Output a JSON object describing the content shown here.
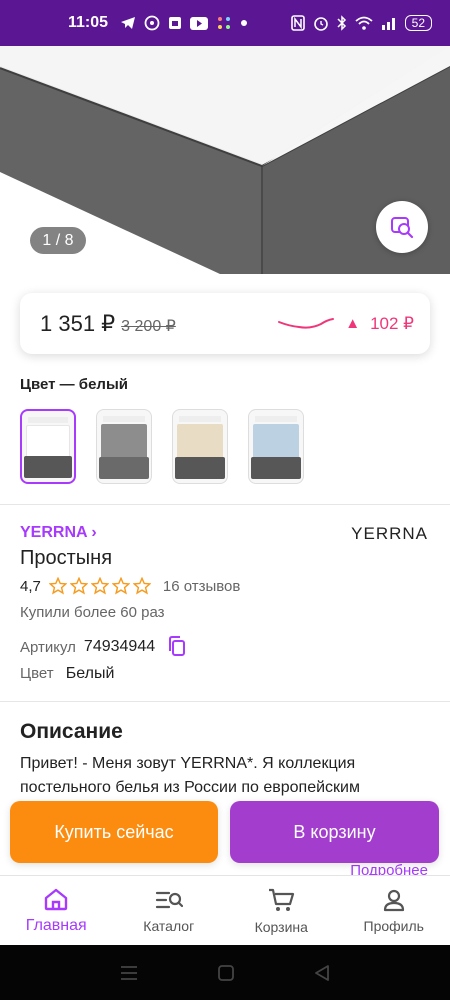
{
  "status_bar": {
    "time": "11:05",
    "battery": "52",
    "left_icons": [
      "telegram-icon",
      "viber-icon",
      "calendar-icon",
      "youtube-icon",
      "app-icon",
      "dot-icon"
    ],
    "right_icons": [
      "nfc-icon",
      "alarm-icon",
      "bluetooth-icon",
      "wifi-icon",
      "signal-icon"
    ]
  },
  "gallery": {
    "counter": "1 / 8"
  },
  "price": {
    "current": "1 351 ₽",
    "old": "3 200 ₽",
    "change": "102 ₽",
    "trend_color": "#f0367a"
  },
  "color": {
    "label": "Цвет — белый",
    "swatches": [
      {
        "name": "white",
        "color": "#ffffff",
        "selected": true
      },
      {
        "name": "gray",
        "color": "#8d8d8d",
        "selected": false
      },
      {
        "name": "beige",
        "color": "#e8dcc4",
        "selected": false
      },
      {
        "name": "blue",
        "color": "#bcd1e2",
        "selected": false
      }
    ]
  },
  "product": {
    "brand_link": "YERRNA ›",
    "brand_logo": "YERRNA",
    "title": "Простыня",
    "rating": "4,7",
    "stars": 5,
    "reviews": "16 отзывов",
    "bought": "Купили более 60 раз",
    "article_label": "Артикул",
    "article_value": "74934944",
    "color_label": "Цвет",
    "color_value": "Белый"
  },
  "description": {
    "title": "Описание",
    "text": "Привет! - Меня зовут YERRNA*. Я коллекция постельного белья из России по европейским",
    "more": "Подробнее"
  },
  "buttons": {
    "buy_now": "Купить сейчас",
    "add_to_cart": "В корзину"
  },
  "bottom_nav": {
    "home": "Главная",
    "catalog": "Каталог",
    "cart": "Корзина",
    "profile": "Профиль"
  },
  "colors": {
    "brand_purple": "#a73afd",
    "status_bar": "#5b1694",
    "buy_orange": "#fb8c10",
    "star": "#f79b1f"
  }
}
